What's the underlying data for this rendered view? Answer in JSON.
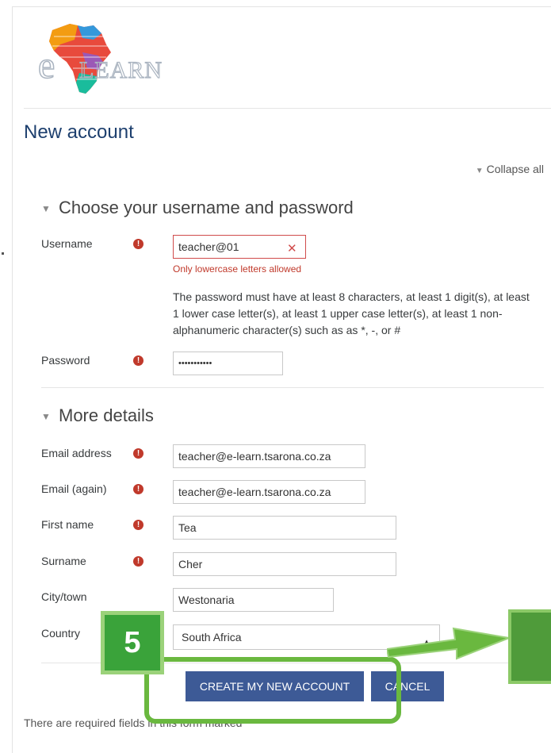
{
  "header": {
    "logo_text": "LEARN",
    "logo_letter": "e"
  },
  "page_title": "New account",
  "collapse_all": "Collapse all",
  "sections": {
    "credentials": {
      "title": "Choose your username and password",
      "username_label": "Username",
      "username_value": "teacher@01",
      "username_error": "Only lowercase letters allowed",
      "password_help": "The password must have at least 8 characters, at least 1 digit(s), at least 1 lower case letter(s), at least 1 upper case letter(s), at least 1 non-alphanumeric character(s) such as as *, -, or #",
      "password_label": "Password",
      "password_value": "•••••••••••"
    },
    "details": {
      "title": "More details",
      "email_label": "Email address",
      "email_value": "teacher@e-learn.tsarona.co.za",
      "email_again_label": "Email (again)",
      "email_again_value": "teacher@e-learn.tsarona.co.za",
      "first_name_label": "First name",
      "first_name_value": "Tea",
      "surname_label": "Surname",
      "surname_value": "Cher",
      "city_label": "City/town",
      "city_value": "Westonaria",
      "country_label": "Country",
      "country_value": "South Africa"
    }
  },
  "buttons": {
    "create": "CREATE MY NEW ACCOUNT",
    "cancel": "CANCEL"
  },
  "footer_note": "There are required fields in this form marked",
  "annotation": {
    "step": "5"
  },
  "colors": {
    "title": "#1d3f6e",
    "button": "#3d5a96",
    "error": "#c0392b",
    "annotation": "#3aa33a"
  },
  "icons": {
    "required": "exclamation-circle-icon",
    "clear": "x-icon",
    "caret": "caret-down-icon"
  }
}
